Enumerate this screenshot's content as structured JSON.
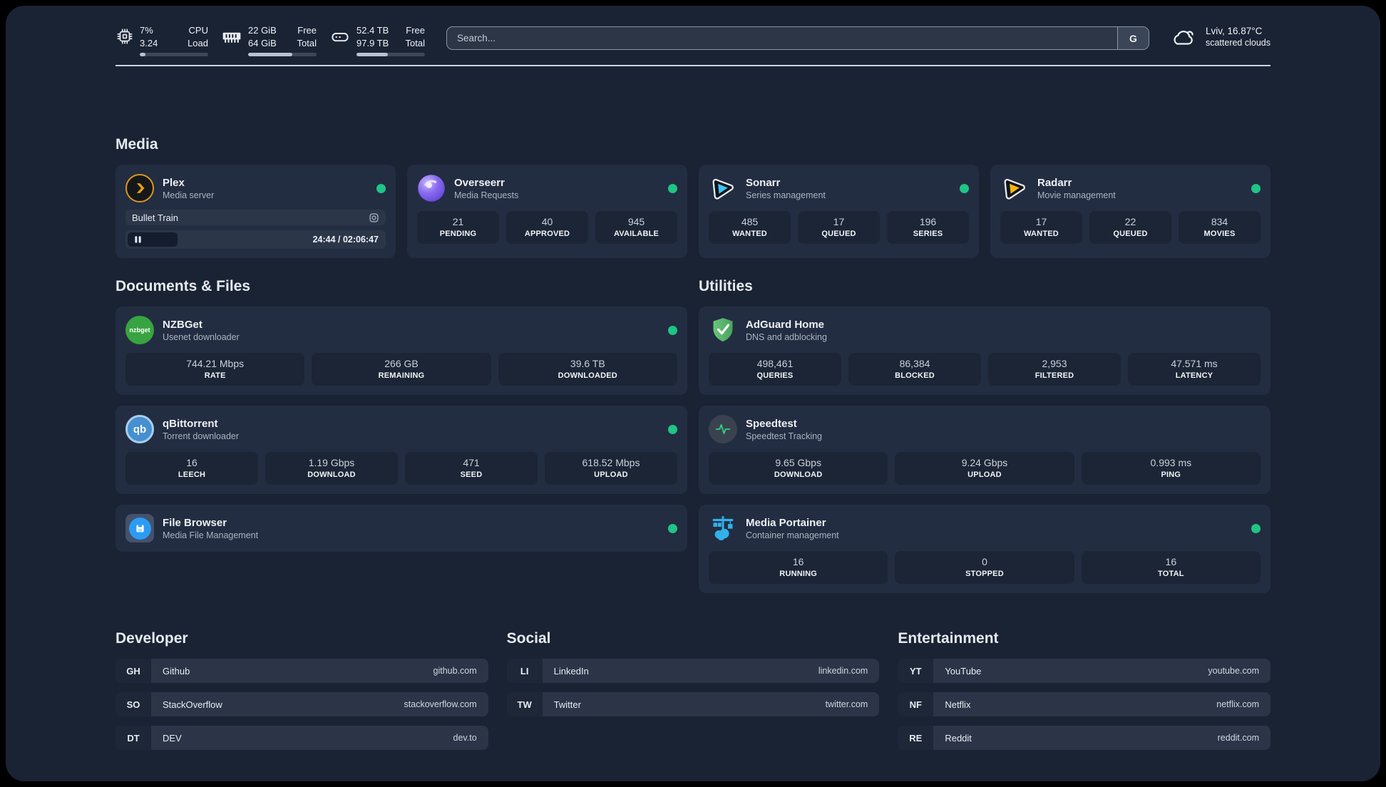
{
  "header": {
    "cpu": {
      "values": [
        "7%",
        "3.24"
      ],
      "labels": [
        "CPU",
        "Load"
      ],
      "progress": 8
    },
    "memory": {
      "values": [
        "22 GiB",
        "64 GiB"
      ],
      "labels": [
        "Free",
        "Total"
      ],
      "progress": 65
    },
    "disk": {
      "values": [
        "52.4 TB",
        "97.9 TB"
      ],
      "labels": [
        "Free",
        "Total"
      ],
      "progress": 46
    },
    "search": {
      "placeholder": "Search...",
      "button_label": "G"
    },
    "weather": {
      "location": "Lviv, 16.87°C",
      "condition": "scattered clouds"
    }
  },
  "sections": {
    "media": "Media",
    "documents": "Documents & Files",
    "utilities": "Utilities",
    "developer": "Developer",
    "social": "Social",
    "entertainment": "Entertainment"
  },
  "apps": {
    "plex": {
      "name": "Plex",
      "desc": "Media server",
      "online": true,
      "now_playing": {
        "title": "Bullet Train",
        "time": "24:44 / 02:06:47"
      }
    },
    "overseerr": {
      "name": "Overseerr",
      "desc": "Media Requests",
      "online": true,
      "stats": [
        {
          "value": "21",
          "label": "PENDING"
        },
        {
          "value": "40",
          "label": "APPROVED"
        },
        {
          "value": "945",
          "label": "AVAILABLE"
        }
      ]
    },
    "sonarr": {
      "name": "Sonarr",
      "desc": "Series management",
      "online": true,
      "stats": [
        {
          "value": "485",
          "label": "WANTED"
        },
        {
          "value": "17",
          "label": "QUEUED"
        },
        {
          "value": "196",
          "label": "SERIES"
        }
      ]
    },
    "radarr": {
      "name": "Radarr",
      "desc": "Movie management",
      "online": true,
      "stats": [
        {
          "value": "17",
          "label": "WANTED"
        },
        {
          "value": "22",
          "label": "QUEUED"
        },
        {
          "value": "834",
          "label": "MOVIES"
        }
      ]
    },
    "nzbget": {
      "name": "NZBGet",
      "desc": "Usenet downloader",
      "online": true,
      "icon_text": "nzbget",
      "stats": [
        {
          "value": "744.21 Mbps",
          "label": "RATE"
        },
        {
          "value": "266 GB",
          "label": "REMAINING"
        },
        {
          "value": "39.6 TB",
          "label": "DOWNLOADED"
        }
      ]
    },
    "qbittorrent": {
      "name": "qBittorrent",
      "desc": "Torrent downloader",
      "online": true,
      "icon_text": "qb",
      "stats": [
        {
          "value": "16",
          "label": "LEECH"
        },
        {
          "value": "1.19 Gbps",
          "label": "DOWNLOAD"
        },
        {
          "value": "471",
          "label": "SEED"
        },
        {
          "value": "618.52 Mbps",
          "label": "UPLOAD"
        }
      ]
    },
    "filebrowser": {
      "name": "File Browser",
      "desc": "Media File Management",
      "online": true
    },
    "adguard": {
      "name": "AdGuard Home",
      "desc": "DNS and adblocking",
      "online": false,
      "stats": [
        {
          "value": "498,461",
          "label": "QUERIES"
        },
        {
          "value": "86,384",
          "label": "BLOCKED"
        },
        {
          "value": "2,953",
          "label": "FILTERED"
        },
        {
          "value": "47.571 ms",
          "label": "LATENCY"
        }
      ]
    },
    "speedtest": {
      "name": "Speedtest",
      "desc": "Speedtest Tracking",
      "online": false,
      "stats": [
        {
          "value": "9.65 Gbps",
          "label": "DOWNLOAD"
        },
        {
          "value": "9.24 Gbps",
          "label": "UPLOAD"
        },
        {
          "value": "0.993 ms",
          "label": "PING"
        }
      ]
    },
    "portainer": {
      "name": "Media Portainer",
      "desc": "Container management",
      "online": true,
      "stats": [
        {
          "value": "16",
          "label": "RUNNING"
        },
        {
          "value": "0",
          "label": "STOPPED"
        },
        {
          "value": "16",
          "label": "TOTAL"
        }
      ]
    }
  },
  "bookmarks": {
    "developer": [
      {
        "abbr": "GH",
        "name": "Github",
        "url": "github.com"
      },
      {
        "abbr": "SO",
        "name": "StackOverflow",
        "url": "stackoverflow.com"
      },
      {
        "abbr": "DT",
        "name": "DEV",
        "url": "dev.to"
      }
    ],
    "social": [
      {
        "abbr": "LI",
        "name": "LinkedIn",
        "url": "linkedin.com"
      },
      {
        "abbr": "TW",
        "name": "Twitter",
        "url": "twitter.com"
      }
    ],
    "entertainment": [
      {
        "abbr": "YT",
        "name": "YouTube",
        "url": "youtube.com"
      },
      {
        "abbr": "NF",
        "name": "Netflix",
        "url": "netflix.com"
      },
      {
        "abbr": "RE",
        "name": "Reddit",
        "url": "reddit.com"
      }
    ]
  },
  "icons": {
    "cpu-icon": "chip outline",
    "memory-icon": "ram stick",
    "disk-icon": "drive box",
    "weather-icon": "cloud outline",
    "gear-icon": "settings gear",
    "pause-icon": "double vertical bars",
    "status-dot": "green circle"
  },
  "colors": {
    "panel_bg": "#1a2334",
    "card_bg": "#232d41",
    "stat_bg": "#1b2535",
    "status_online": "#1fc585",
    "plex_amber": "#e8a00c",
    "sonarr_cyan": "#3ec3f2",
    "radarr_amber": "#f6b60c",
    "adguard_green": "#5bb96b",
    "portainer_blue": "#31b1ea",
    "qbittorrent_blue": "#468fd0",
    "nzbget_green": "#38a441",
    "filebrowser_blue": "#2b9bf3",
    "overseerr_purple": "#8b6cf0",
    "speedtest_green": "#2fd180"
  }
}
